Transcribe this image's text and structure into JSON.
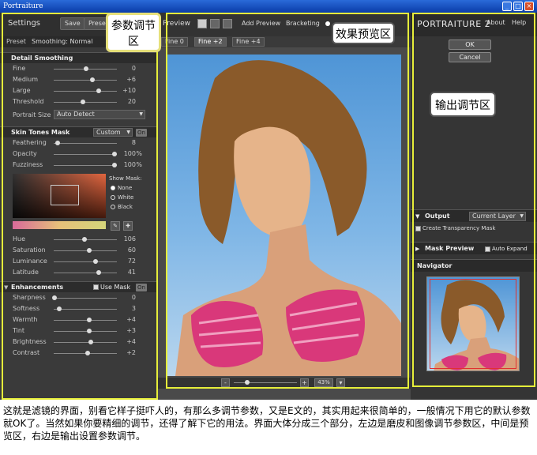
{
  "window": {
    "title": "Portraiture"
  },
  "left_panel": {
    "title": "Settings",
    "save_label": "Save",
    "preset_btn": "Preset",
    "preset_label": "Preset",
    "preset_value": "Smoothing: Normal",
    "detail": {
      "header": "Detail Smoothing",
      "rows": [
        {
          "label": "Fine",
          "value": "0"
        },
        {
          "label": "Medium",
          "value": "+6"
        },
        {
          "label": "Large",
          "value": "+10"
        },
        {
          "label": "Threshold",
          "value": "20"
        }
      ],
      "portrait_size_label": "Portrait Size",
      "portrait_size_value": "Auto Detect"
    },
    "skin": {
      "header": "Skin Tones Mask",
      "mode": "Custom",
      "on": "On",
      "rows": [
        {
          "label": "Feathering",
          "value": "8",
          "unit": ""
        },
        {
          "label": "Opacity",
          "value": "100",
          "unit": "%"
        },
        {
          "label": "Fuzziness",
          "value": "100",
          "unit": "%"
        }
      ],
      "show_mask_label": "Show Mask:",
      "show_mask_options": [
        "None",
        "White",
        "Black"
      ],
      "hsl_rows": [
        {
          "label": "Hue",
          "value": "106"
        },
        {
          "label": "Saturation",
          "value": "60"
        },
        {
          "label": "Luminance",
          "value": "72"
        },
        {
          "label": "Latitude",
          "value": "41"
        }
      ]
    },
    "enh": {
      "header": "Enhancements",
      "use_mask": "Use Mask",
      "on": "On",
      "rows": [
        {
          "label": "Sharpness",
          "value": "0"
        },
        {
          "label": "Softness",
          "value": "3"
        },
        {
          "label": "Warmth",
          "value": "+4"
        },
        {
          "label": "Tint",
          "value": "+3"
        },
        {
          "label": "Brightness",
          "value": "+4"
        },
        {
          "label": "Contrast",
          "value": "+2"
        }
      ]
    }
  },
  "center": {
    "preview_label": "Preview",
    "add_preview": "Add Preview",
    "bracketing": "Bracketing",
    "tabs": [
      "Fine 0",
      "Fine +2",
      "Fine +4"
    ],
    "zoom": "43%"
  },
  "right_panel": {
    "brand": "PORTRAITURE 2",
    "about": "About",
    "help": "Help",
    "ok": "OK",
    "cancel": "Cancel",
    "output_label": "Output",
    "output_value": "Current Layer",
    "create_mask": "Create Transparency Mask",
    "mask_preview": "Mask Preview",
    "auto_expand": "Auto Expand",
    "navigator": "Navigator"
  },
  "annotations": {
    "left": "参数调节区",
    "center": "效果预览区",
    "right": "输出调节区"
  },
  "caption": "这就是滤镜的界面，别看它样子挺吓人的，有那么多调节参数，又是E文的，其实用起来很简单的，一般情况下用它的默认参数就OK了。当然如果你要精细的调节，还得了解下它的用法。界面大体分成三个部分，左边是磨皮和图像调节参数区，中间是预览区，右边是输出设置参数调节。",
  "colors": {
    "annotation_frame": "#e6ee3a",
    "caption_text": "#000000"
  }
}
